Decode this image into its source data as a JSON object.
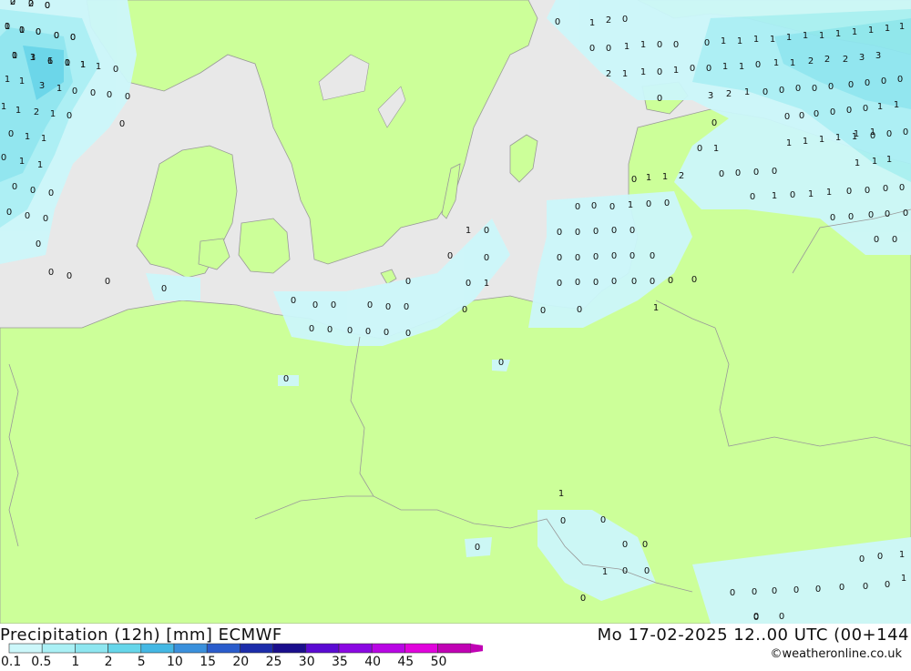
{
  "title_left": "Precipitation (12h) [mm] ECMWF",
  "title_right": "Mo 17-02-2025 12..00 UTC (00+144",
  "credit": "©weatheronline.co.uk",
  "colors": {
    "sea": "#e8e8e8",
    "land": "#ccff99",
    "border": "#999999"
  },
  "legend": {
    "labels": [
      "0.1",
      "0.5",
      "1",
      "2",
      "5",
      "10",
      "15",
      "20",
      "25",
      "30",
      "35",
      "40",
      "45",
      "50"
    ],
    "colors": [
      "#ccf7fa",
      "#aaf0f5",
      "#8ee6f0",
      "#66d6ea",
      "#44b8e4",
      "#3a90dc",
      "#2a5ccc",
      "#1c2caa",
      "#1a0e8c",
      "#5a0ad2",
      "#8a08e2",
      "#b806e4",
      "#e004dc",
      "#c002b4"
    ]
  },
  "stations": [
    {
      "t": "2"
    },
    {
      "t": "2"
    },
    {
      "t": "0"
    },
    {
      "t": "1"
    },
    {
      "t": "1"
    },
    {
      "t": "0"
    },
    {
      "t": "0"
    },
    {
      "t": "0"
    },
    {
      "t": "1"
    },
    {
      "t": "3"
    },
    {
      "t": "6"
    },
    {
      "t": "1"
    },
    {
      "t": "1"
    },
    {
      "t": "1"
    },
    {
      "t": "0"
    },
    {
      "t": "1"
    },
    {
      "t": "1"
    },
    {
      "t": "3"
    },
    {
      "t": "1"
    },
    {
      "t": "0"
    },
    {
      "t": "0"
    },
    {
      "t": "0"
    },
    {
      "t": "0"
    },
    {
      "t": "1"
    },
    {
      "t": "1"
    },
    {
      "t": "2"
    },
    {
      "t": "1"
    },
    {
      "t": "0"
    },
    {
      "t": "0"
    },
    {
      "t": "0"
    },
    {
      "t": "1"
    },
    {
      "t": "1"
    },
    {
      "t": "0"
    },
    {
      "t": "1"
    },
    {
      "t": "1"
    },
    {
      "t": "0"
    },
    {
      "t": "0"
    },
    {
      "t": "0"
    },
    {
      "t": "0"
    },
    {
      "t": "0"
    },
    {
      "t": "0"
    },
    {
      "t": "0"
    },
    {
      "t": "0"
    },
    {
      "t": "0"
    },
    {
      "t": "0"
    },
    {
      "t": "0"
    },
    {
      "t": "0"
    },
    {
      "t": "0"
    },
    {
      "t": "1"
    },
    {
      "t": "2"
    },
    {
      "t": "0"
    },
    {
      "t": "0"
    },
    {
      "t": "0"
    },
    {
      "t": "1"
    },
    {
      "t": "1"
    },
    {
      "t": "0"
    },
    {
      "t": "0"
    },
    {
      "t": "0"
    },
    {
      "t": "1"
    },
    {
      "t": "1"
    },
    {
      "t": "1"
    },
    {
      "t": "1"
    },
    {
      "t": "1"
    },
    {
      "t": "1"
    },
    {
      "t": "1"
    },
    {
      "t": "1"
    },
    {
      "t": "1"
    },
    {
      "t": "1"
    },
    {
      "t": "1"
    },
    {
      "t": "1"
    },
    {
      "t": "2"
    },
    {
      "t": "1"
    },
    {
      "t": "1"
    },
    {
      "t": "0"
    },
    {
      "t": "1"
    },
    {
      "t": "0"
    },
    {
      "t": "0"
    },
    {
      "t": "1"
    },
    {
      "t": "1"
    },
    {
      "t": "0"
    },
    {
      "t": "1"
    },
    {
      "t": "1"
    },
    {
      "t": "2"
    },
    {
      "t": "2"
    },
    {
      "t": "2"
    },
    {
      "t": "3"
    },
    {
      "t": "3"
    },
    {
      "t": "3"
    },
    {
      "t": "2"
    },
    {
      "t": "1"
    },
    {
      "t": "0"
    },
    {
      "t": "0"
    },
    {
      "t": "0"
    },
    {
      "t": "0"
    },
    {
      "t": "0"
    },
    {
      "t": "0"
    },
    {
      "t": "0"
    },
    {
      "t": "0"
    },
    {
      "t": "0"
    },
    {
      "t": "0"
    },
    {
      "t": "0"
    },
    {
      "t": "0"
    },
    {
      "t": "0"
    },
    {
      "t": "0"
    },
    {
      "t": "0"
    },
    {
      "t": "0"
    },
    {
      "t": "0"
    },
    {
      "t": "1"
    },
    {
      "t": "1"
    },
    {
      "t": "1"
    },
    {
      "t": "1"
    },
    {
      "t": "1"
    },
    {
      "t": "1"
    },
    {
      "t": "1"
    },
    {
      "t": "1"
    },
    {
      "t": "1"
    },
    {
      "t": "0"
    },
    {
      "t": "0"
    },
    {
      "t": "0"
    },
    {
      "t": "0"
    },
    {
      "t": "1"
    },
    {
      "t": "1"
    },
    {
      "t": "1"
    },
    {
      "t": "1"
    },
    {
      "t": "0"
    },
    {
      "t": "0"
    },
    {
      "t": "0"
    },
    {
      "t": "0"
    },
    {
      "t": "0"
    },
    {
      "t": "1"
    },
    {
      "t": "1"
    },
    {
      "t": "2"
    },
    {
      "t": "0"
    },
    {
      "t": "1"
    },
    {
      "t": "0"
    },
    {
      "t": "1"
    },
    {
      "t": "1"
    },
    {
      "t": "0"
    },
    {
      "t": "0"
    },
    {
      "t": "0"
    },
    {
      "t": "0"
    },
    {
      "t": "0"
    },
    {
      "t": "0"
    },
    {
      "t": "0"
    },
    {
      "t": "1"
    },
    {
      "t": "0"
    },
    {
      "t": "0"
    },
    {
      "t": "0"
    },
    {
      "t": "0"
    },
    {
      "t": "0"
    },
    {
      "t": "0"
    },
    {
      "t": "0"
    },
    {
      "t": "0"
    },
    {
      "t": "0"
    },
    {
      "t": "0"
    },
    {
      "t": "1"
    },
    {
      "t": "0"
    },
    {
      "t": "0"
    },
    {
      "t": "0"
    },
    {
      "t": "0"
    },
    {
      "t": "0"
    },
    {
      "t": "0"
    },
    {
      "t": "0"
    },
    {
      "t": "0"
    },
    {
      "t": "0"
    },
    {
      "t": "0"
    },
    {
      "t": "0"
    },
    {
      "t": "0"
    },
    {
      "t": "0"
    },
    {
      "t": "0"
    },
    {
      "t": "0"
    },
    {
      "t": "0"
    },
    {
      "t": "0"
    },
    {
      "t": "0"
    },
    {
      "t": "0"
    },
    {
      "t": "0"
    },
    {
      "t": "0"
    },
    {
      "t": "0"
    },
    {
      "t": "1"
    },
    {
      "t": "0"
    },
    {
      "t": "0"
    },
    {
      "t": "0"
    },
    {
      "t": "0"
    },
    {
      "t": "0"
    },
    {
      "t": "0"
    },
    {
      "t": "0"
    },
    {
      "t": "0"
    },
    {
      "t": "1"
    },
    {
      "t": "0"
    },
    {
      "t": "0"
    },
    {
      "t": "0"
    },
    {
      "t": "0"
    },
    {
      "t": "0"
    },
    {
      "t": "0"
    },
    {
      "t": "0"
    },
    {
      "t": "0"
    },
    {
      "t": "0"
    },
    {
      "t": "0"
    },
    {
      "t": "1"
    },
    {
      "t": "0"
    },
    {
      "t": "0"
    },
    {
      "t": "0"
    },
    {
      "t": "0"
    },
    {
      "t": "0"
    },
    {
      "t": "1"
    },
    {
      "t": "0"
    },
    {
      "t": "0"
    },
    {
      "t": "0"
    },
    {
      "t": "0"
    },
    {
      "t": "0"
    },
    {
      "t": "0"
    },
    {
      "t": "0"
    },
    {
      "t": "0"
    },
    {
      "t": "0"
    },
    {
      "t": "0"
    },
    {
      "t": "0"
    },
    {
      "t": "0"
    },
    {
      "t": "0"
    },
    {
      "t": "0"
    },
    {
      "t": "0"
    },
    {
      "t": "0"
    },
    {
      "t": "0"
    },
    {
      "t": "1"
    },
    {
      "t": "1"
    },
    {
      "t": "0"
    },
    {
      "t": "0"
    },
    {
      "t": "0"
    },
    {
      "t": "0"
    },
    {
      "t": "0"
    },
    {
      "t": "0"
    },
    {
      "t": "0"
    },
    {
      "t": "0"
    },
    {
      "t": "0"
    },
    {
      "t": "1"
    },
    {
      "t": "1"
    },
    {
      "t": "0"
    },
    {
      "t": "1"
    }
  ]
}
